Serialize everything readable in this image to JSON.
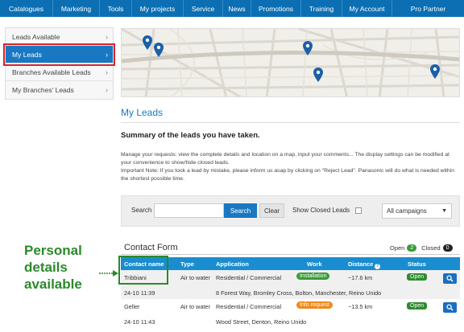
{
  "nav": {
    "items": [
      "Catalogues",
      "Marketing",
      "Tools",
      "My projects",
      "Service",
      "News",
      "Promotions",
      "Training",
      "My Account",
      "Pro Partner"
    ]
  },
  "sidebar": {
    "items": [
      {
        "label": "Leads Available",
        "active": false
      },
      {
        "label": "My Leads",
        "active": true
      },
      {
        "label": "Branches Available Leads",
        "active": false
      },
      {
        "label": "My Branches' Leads",
        "active": false
      }
    ]
  },
  "page": {
    "title": "My Leads",
    "summary": "Summary of the leads you have taken.",
    "desc1": "Manage your requests: view the complete details and location on a map, input your comments... The display settings can be modified at your convenience to show/hide closed leads.",
    "desc2": "Important Note: If you took a lead by mistake, please inform us asap by clicking on \"Reject Lead\". Panasonic will do what is needed within the shortest possible time."
  },
  "search": {
    "label": "Search",
    "value": "",
    "search_button": "Search",
    "clear_button": "Clear",
    "closed_label": "Show Closed Leads",
    "campaign": "All campaigns"
  },
  "annotation": {
    "line1": "Personal",
    "line2": "details",
    "line3": "available"
  },
  "contact_form": {
    "title": "Contact Form",
    "open_label": "Open",
    "open_count": "2",
    "closed_label": "Closed",
    "closed_count": "0",
    "headers": [
      "Contact name",
      "Type",
      "Application",
      "Work",
      "Distance",
      "Status"
    ],
    "rows": [
      {
        "name": "Tribbiani",
        "date": "24-10 11:39",
        "type": "Air to water",
        "application": "Residential / Commercial",
        "address": "8 Forest Way, Bromley Cross, Bolton, Manchester, Reino Unido",
        "work": "Installation",
        "work_color": "#3a9b3a",
        "distance": "~17.6 km",
        "status": "Open"
      },
      {
        "name": "Geller",
        "date": "24-10 11:43",
        "type": "Air to water",
        "application": "Residential / Commercial",
        "address": "Wood Street, Denton, Reino Unido",
        "work": "Info request",
        "work_color": "#ef8a1a",
        "distance": "~13.5 km",
        "status": "Open"
      }
    ]
  },
  "colors": {
    "nav_bg": "#0c6fb3",
    "accent": "#1a78c2",
    "annotation_green": "#2a8a2a",
    "highlight_red": "#d9242b"
  }
}
